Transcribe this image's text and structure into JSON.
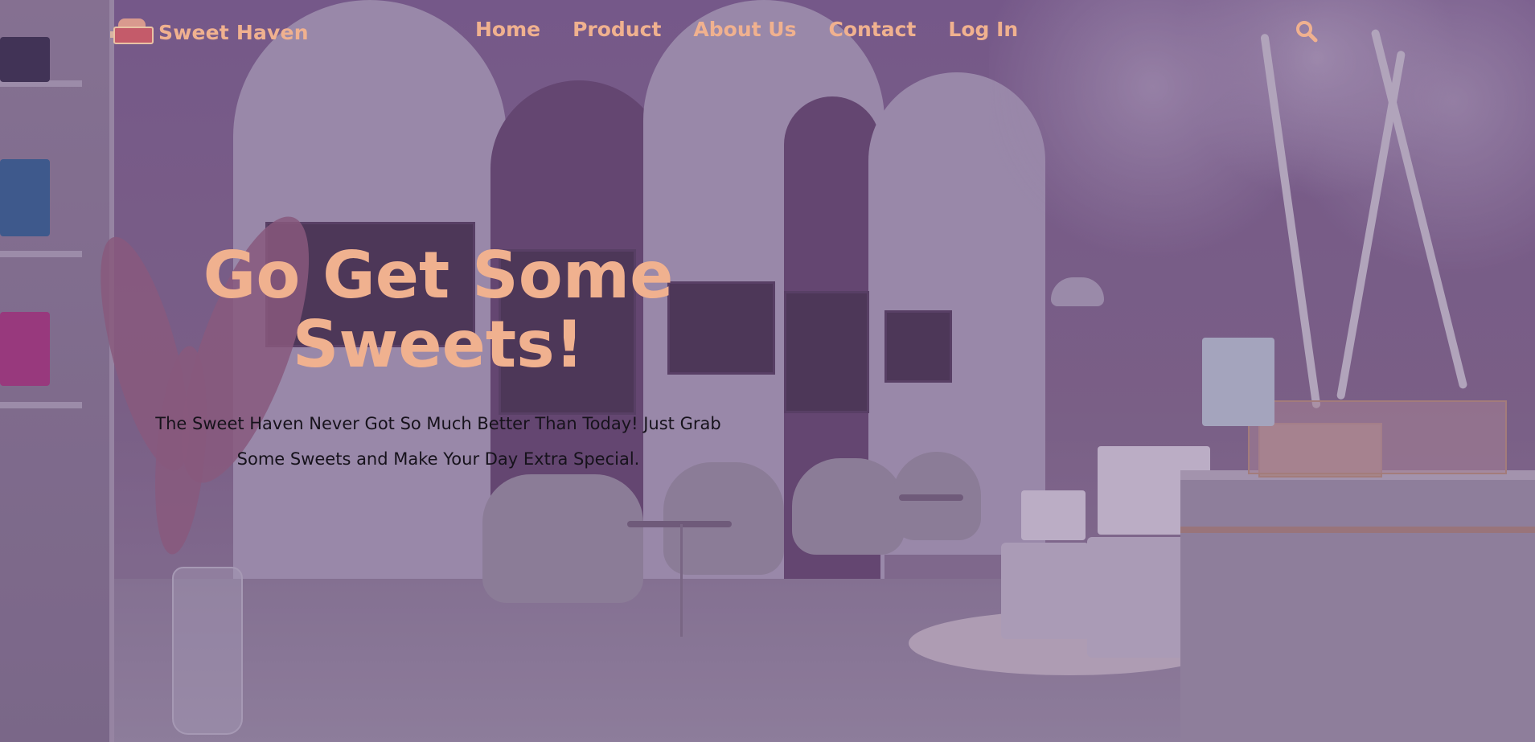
{
  "brand": {
    "name": "Sweet Haven",
    "logo_icon": "bakery-shop-logo"
  },
  "nav": {
    "items": [
      {
        "label": "Home"
      },
      {
        "label": "Product"
      },
      {
        "label": "About Us"
      },
      {
        "label": "Contact"
      },
      {
        "label": "Log In"
      }
    ],
    "search_icon": "search-icon"
  },
  "hero": {
    "headline": "Go Get Some Sweets!",
    "subtext": "The Sweet Haven Never Got So Much Better Than Today! Just Grab Some Sweets and Make Your Day Extra Special."
  },
  "colors": {
    "accent": "#f0b18f",
    "body_text": "#16121b",
    "overlay": "#4a2f5f"
  }
}
